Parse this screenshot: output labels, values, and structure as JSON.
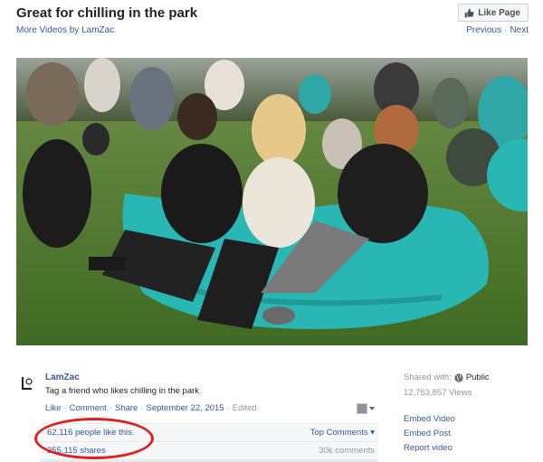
{
  "header": {
    "title": "Great for chilling in the park",
    "more_videos": "More Videos by LamZac",
    "like_page_label": "Like Page",
    "previous_label": "Previous",
    "separator": "·",
    "next_label": "Next"
  },
  "video": {
    "icon": "video-frame"
  },
  "post": {
    "author": "LamZac",
    "caption": "Tag a friend who likes chilling in the park",
    "actions": {
      "like": "Like",
      "comment": "Comment",
      "share": "Share",
      "date": "September 22, 2015",
      "edited": "Edited",
      "dot": "·"
    }
  },
  "stats": {
    "likes": "62,116 people like this.",
    "top_comments": "Top Comments ▾",
    "shares": "255,115 shares",
    "comments": "30k comments"
  },
  "sidebar": {
    "shared_with_label": "Shared with:",
    "privacy": "Public",
    "views": "12,753,857 Views",
    "links": [
      "Embed Video",
      "Embed Post",
      "Report video"
    ]
  },
  "colors": {
    "link": "#365899",
    "highlight_circle": "#e0201e",
    "bean_bag": "#29b7b3"
  }
}
